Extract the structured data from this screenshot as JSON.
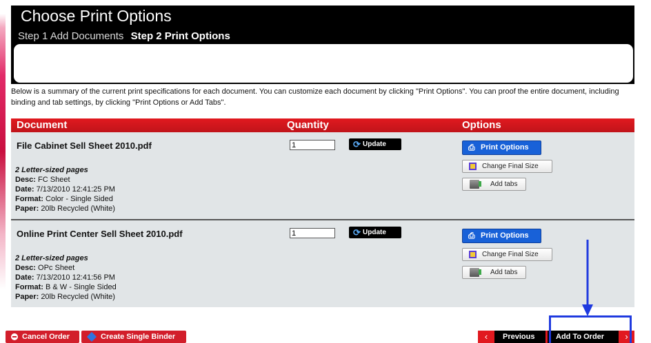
{
  "title": "Choose Print Options",
  "steps": {
    "step1": "Step 1 Add Documents",
    "step2": "Step 2 Print Options"
  },
  "intro": "Below is a summary of the current print specifications for each document. You can customize each document by clicking \"Print Options\". You can proof the entire document, including binding and tab settings, by clicking \"Print Options or Add Tabs\".",
  "columns": {
    "document": "Document",
    "quantity": "Quantity",
    "options": "Options"
  },
  "documents": [
    {
      "name": "File Cabinet Sell Sheet 2010.pdf",
      "pages": "2 Letter-sized pages",
      "desc_label": "Desc:",
      "desc": "FC Sheet",
      "date_label": "Date:",
      "date": "7/13/2010 12:41:25 PM",
      "format_label": "Format:",
      "format": "Color - Single Sided",
      "paper_label": "Paper:",
      "paper": "20lb Recycled (White)",
      "quantity": "1"
    },
    {
      "name": "Online Print Center Sell Sheet 2010.pdf",
      "pages": "2 Letter-sized pages",
      "desc_label": "Desc:",
      "desc": "OPc Sheet",
      "date_label": "Date:",
      "date": "7/13/2010 12:41:56 PM",
      "format_label": "Format:",
      "format": "B & W - Single Sided",
      "paper_label": "Paper:",
      "paper": "20lb Recycled (White)",
      "quantity": "1"
    }
  ],
  "buttons": {
    "update": "Update",
    "print_options": "Print Options",
    "change_final_size": "Change Final Size",
    "add_tabs": "Add tabs",
    "cancel_order": "Cancel Order",
    "create_single_binder": "Create Single Binder",
    "previous": "Previous",
    "add_to_order": "Add To Order"
  },
  "icons": {
    "update": "refresh-icon",
    "print_options": "printer-icon",
    "change_final_size": "resize-icon",
    "add_tabs": "tabs-icon",
    "cancel_order": "minus-circle-icon",
    "create_single_binder": "binder-icon",
    "previous": "chevron-left-icon",
    "next": "chevron-right-icon"
  },
  "colors": {
    "header_red": "#e1191f",
    "row_gray": "#e1e5e7",
    "button_blue": "#1861d8",
    "annotation_blue": "#1f3adf"
  }
}
